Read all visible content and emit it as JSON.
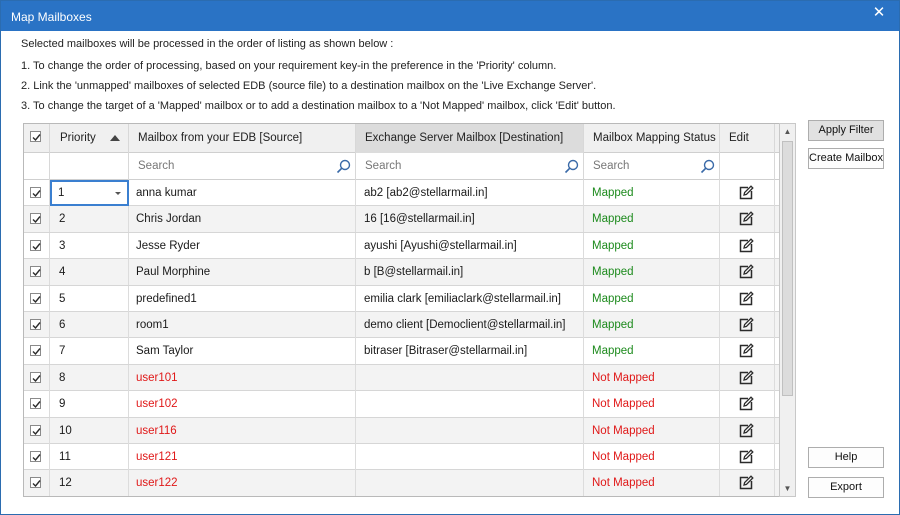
{
  "window": {
    "title": "Map Mailboxes"
  },
  "instructions": {
    "intro": "Selected mailboxes will be processed in the order of listing as shown below :",
    "step1": "1. To change the order of processing, based on your requirement key-in the preference in the 'Priority' column.",
    "step2": "2. Link the 'unmapped' mailboxes of selected EDB (source file) to a destination mailbox on the 'Live Exchange Server'.",
    "step3": "3. To change the target of a 'Mapped' mailbox or to add a destination mailbox to a 'Not Mapped' mailbox, click 'Edit' button."
  },
  "table": {
    "headers": {
      "priority": "Priority",
      "source": "Mailbox from your EDB [Source]",
      "destination": "Exchange Server Mailbox [Destination]",
      "status": "Mailbox Mapping Status",
      "edit": "Edit"
    },
    "search_placeholder": "Search",
    "rows": [
      {
        "priority": "1",
        "source": "anna kumar",
        "destination": "ab2 [ab2@stellarmail.in]",
        "status": "Mapped"
      },
      {
        "priority": "2",
        "source": "Chris Jordan",
        "destination": "16 [16@stellarmail.in]",
        "status": "Mapped"
      },
      {
        "priority": "3",
        "source": "Jesse Ryder",
        "destination": "ayushi [Ayushi@stellarmail.in]",
        "status": "Mapped"
      },
      {
        "priority": "4",
        "source": "Paul Morphine",
        "destination": "b [B@stellarmail.in]",
        "status": "Mapped"
      },
      {
        "priority": "5",
        "source": "predefined1",
        "destination": "emilia clark [emiliaclark@stellarmail.in]",
        "status": "Mapped"
      },
      {
        "priority": "6",
        "source": "room1",
        "destination": "demo client [Democlient@stellarmail.in]",
        "status": "Mapped"
      },
      {
        "priority": "7",
        "source": "Sam Taylor",
        "destination": "bitraser [Bitraser@stellarmail.in]",
        "status": "Mapped"
      },
      {
        "priority": "8",
        "source": "user101",
        "destination": "",
        "status": "Not Mapped"
      },
      {
        "priority": "9",
        "source": "user102",
        "destination": "",
        "status": "Not Mapped"
      },
      {
        "priority": "10",
        "source": "user116",
        "destination": "",
        "status": "Not Mapped"
      },
      {
        "priority": "11",
        "source": "user121",
        "destination": "",
        "status": "Not Mapped"
      },
      {
        "priority": "12",
        "source": "user122",
        "destination": "",
        "status": "Not Mapped"
      }
    ]
  },
  "buttons": {
    "apply_filter": "Apply Filter",
    "create_mailbox": "Create Mailbox",
    "help": "Help",
    "export": "Export"
  },
  "colors": {
    "titlebar": "#2a73c5",
    "mapped": "#1c8a1c",
    "not_mapped": "#e01818"
  },
  "icons": {
    "close": "close-icon",
    "search": "search-icon",
    "edit": "edit-icon",
    "checkbox": "checkbox-checked-icon"
  }
}
